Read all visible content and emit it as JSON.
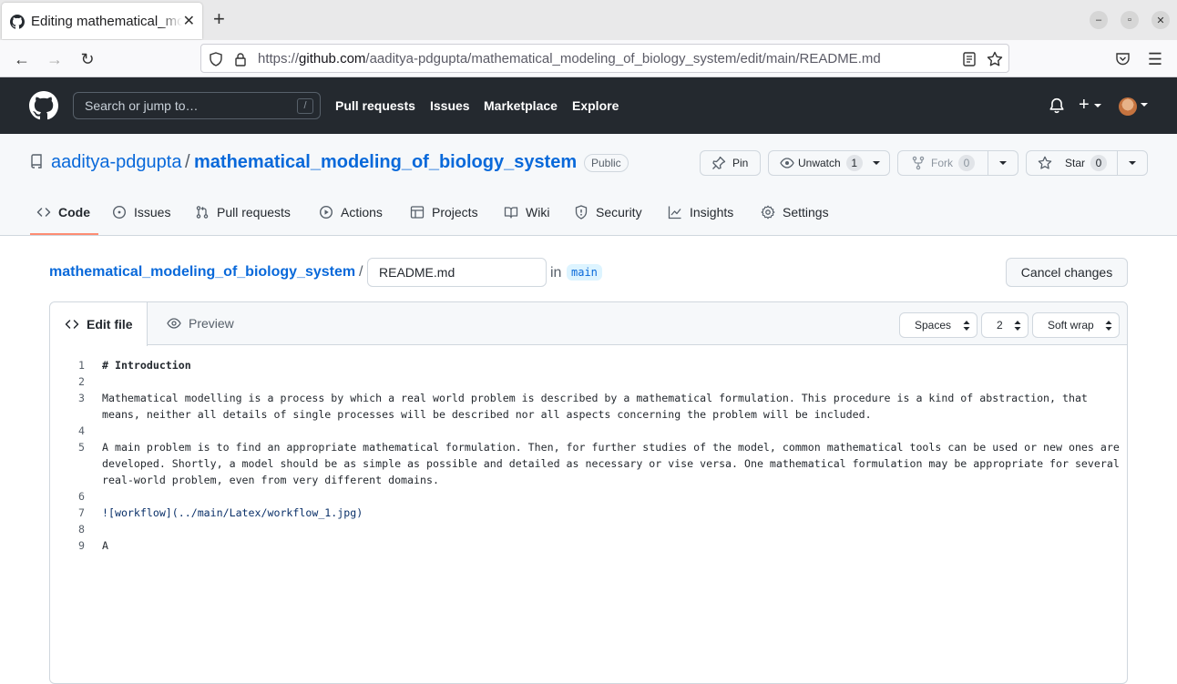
{
  "browser": {
    "tab_title": "Editing mathematical_modeling_of_biology_system",
    "url_prefix": "https://",
    "url_host": "github.com",
    "url_path": "/aaditya-pdgupta/mathematical_modeling_of_biology_system/edit/main/README.md"
  },
  "header": {
    "search_placeholder": "Search or jump to…",
    "search_key": "/",
    "nav": [
      "Pull requests",
      "Issues",
      "Marketplace",
      "Explore"
    ]
  },
  "repo": {
    "owner": "aaditya-pdgupta",
    "name": "mathematical_modeling_of_biology_system",
    "visibility": "Public",
    "pin_label": "Pin",
    "unwatch_label": "Unwatch",
    "watch_count": "1",
    "fork_label": "Fork",
    "fork_count": "0",
    "star_label": "Star",
    "star_count": "0",
    "tabs": [
      "Code",
      "Issues",
      "Pull requests",
      "Actions",
      "Projects",
      "Wiki",
      "Security",
      "Insights",
      "Settings"
    ]
  },
  "edit": {
    "filename": "README.md",
    "in_label": "in",
    "branch": "main",
    "cancel_label": "Cancel changes",
    "edit_tab": "Edit file",
    "preview_tab": "Preview",
    "indent_mode": "Spaces",
    "indent_size": "2",
    "wrap_mode": "Soft wrap"
  },
  "code_lines": [
    {
      "n": "1",
      "text": "# Introduction"
    },
    {
      "n": "2",
      "text": ""
    },
    {
      "n": "3",
      "text": "Mathematical modelling is a process by which a real world problem is described by a mathematical formulation. This procedure is a kind of abstraction, that means, neither all details of single processes will be described nor all aspects concerning the problem will be included."
    },
    {
      "n": "4",
      "text": ""
    },
    {
      "n": "5",
      "text": "A main problem is to find an appropriate mathematical formulation. Then, for further studies of the model, common mathematical tools can be used or new ones are developed. Shortly, a model should be as simple as possible and detailed as necessary or vise versa. One mathematical formulation may be appropriate for several real-world problem, even from very different domains."
    },
    {
      "n": "6",
      "text": ""
    },
    {
      "n": "7",
      "text": "![workflow](../main/Latex/workflow_1.jpg)"
    },
    {
      "n": "8",
      "text": ""
    },
    {
      "n": "9",
      "text": "A"
    }
  ],
  "colors": {
    "link": "#0969da",
    "header_bg": "#24292f",
    "tab_underline": "#fd8c73"
  }
}
